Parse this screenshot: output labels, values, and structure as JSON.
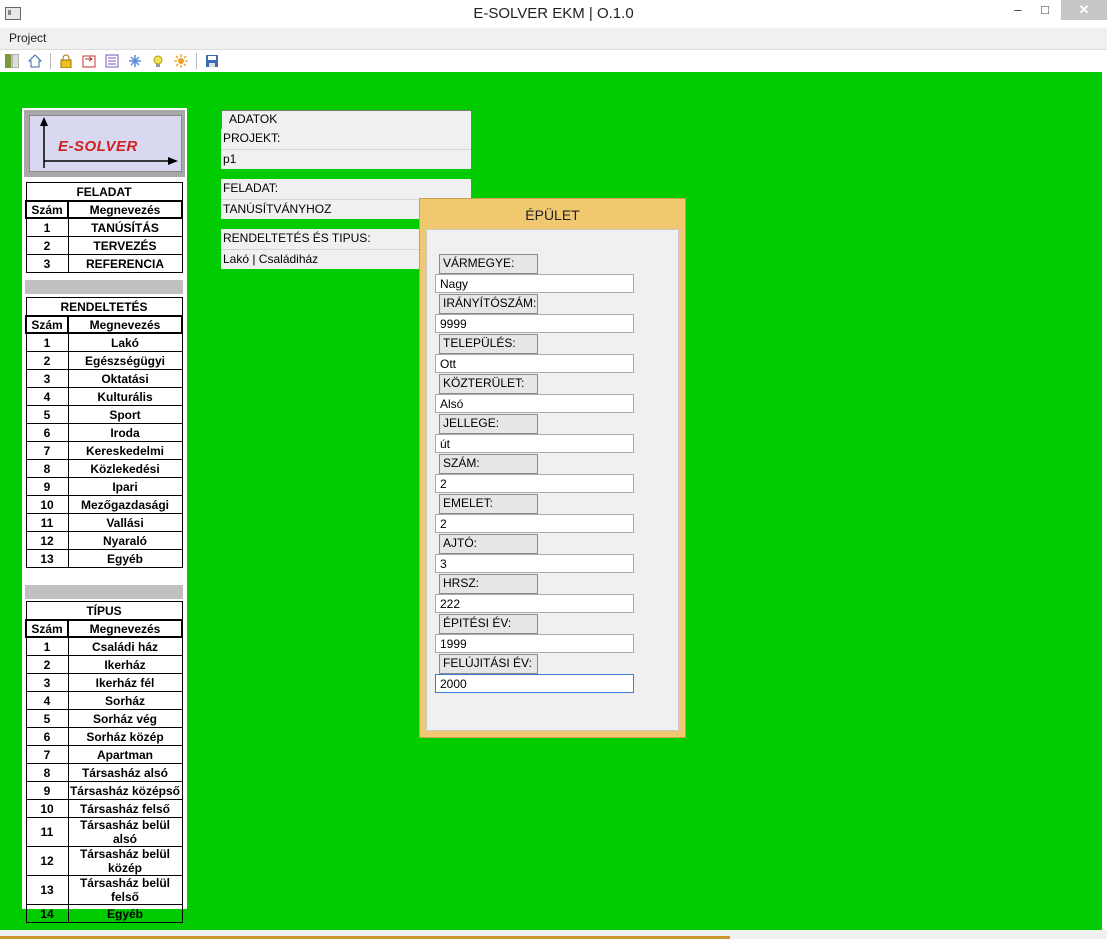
{
  "window": {
    "title": "E-SOLVER EKM | O.1.0",
    "minimize": "–",
    "maximize": "□",
    "close": "✕"
  },
  "menu": {
    "project": "Project"
  },
  "toolbar": {
    "icons": [
      "panel-icon",
      "home-icon",
      "lock-icon",
      "export-icon",
      "list-icon",
      "snowflake-icon",
      "lightbulb-icon",
      "sun-icon",
      "save-icon"
    ]
  },
  "logo": {
    "text": "E-SOLVER"
  },
  "feladat": {
    "title": "FELADAT",
    "col_num": "Szám",
    "col_name": "Megnevezés",
    "rows": [
      {
        "num": "1",
        "name": "TANÚSÍTÁS"
      },
      {
        "num": "2",
        "name": "TERVEZÉS"
      },
      {
        "num": "3",
        "name": "REFERENCIA"
      }
    ]
  },
  "rendeltetes": {
    "title": "RENDELTETÉS",
    "col_num": "Szám",
    "col_name": "Megnevezés",
    "rows": [
      {
        "num": "1",
        "name": "Lakó"
      },
      {
        "num": "2",
        "name": "Egészségügyi"
      },
      {
        "num": "3",
        "name": "Oktatási"
      },
      {
        "num": "4",
        "name": "Kulturális"
      },
      {
        "num": "5",
        "name": "Sport"
      },
      {
        "num": "6",
        "name": "Iroda"
      },
      {
        "num": "7",
        "name": "Kereskedelmi"
      },
      {
        "num": "8",
        "name": "Közlekedési"
      },
      {
        "num": "9",
        "name": "Ipari"
      },
      {
        "num": "10",
        "name": "Mezőgazdasági"
      },
      {
        "num": "11",
        "name": "Vallási"
      },
      {
        "num": "12",
        "name": "Nyaraló"
      },
      {
        "num": "13",
        "name": "Egyéb"
      }
    ]
  },
  "tipus": {
    "title": "TÍPUS",
    "col_num": "Szám",
    "col_name": "Megnevezés",
    "rows": [
      {
        "num": "1",
        "name": "Családi ház"
      },
      {
        "num": "2",
        "name": "Ikerház"
      },
      {
        "num": "3",
        "name": "Ikerház fél"
      },
      {
        "num": "4",
        "name": "Sorház"
      },
      {
        "num": "5",
        "name": "Sorház vég"
      },
      {
        "num": "6",
        "name": "Sorház közép"
      },
      {
        "num": "7",
        "name": "Apartman"
      },
      {
        "num": "8",
        "name": "Társasház alsó"
      },
      {
        "num": "9",
        "name": "Társasház középső"
      },
      {
        "num": "10",
        "name": "Társasház felső"
      },
      {
        "num": "11",
        "name": "Társasház belül alsó"
      },
      {
        "num": "12",
        "name": "Társasház belül közép"
      },
      {
        "num": "13",
        "name": "Társasház belül felső"
      },
      {
        "num": "14",
        "name": "Egyéb"
      }
    ]
  },
  "adatok": {
    "title": "ADATOK",
    "projekt_label": "PROJEKT:",
    "projekt_value": "p1",
    "feladat_label": "FELADAT:",
    "feladat_value": "TANÚSÍTVÁNYHOZ",
    "rendeltetes_label": "RENDELTETÉS ÉS TIPUS:",
    "rendeltetes_value": "Lakó  |  Családiház"
  },
  "epulet": {
    "title": "ÉPÜLET",
    "fields": [
      {
        "label": "VÁRMEGYE:",
        "value": "Nagy"
      },
      {
        "label": "IRÁNYÍTÓSZÁM:",
        "value": "9999"
      },
      {
        "label": "TELEPÜLÉS:",
        "value": "Ott"
      },
      {
        "label": "KÖZTERÜLET:",
        "value": "Alsó"
      },
      {
        "label": "JELLEGE:",
        "value": "út"
      },
      {
        "label": "SZÁM:",
        "value": "2"
      },
      {
        "label": "EMELET:",
        "value": "2"
      },
      {
        "label": "AJTÓ:",
        "value": "3"
      },
      {
        "label": "HRSZ:",
        "value": "222"
      },
      {
        "label": "ÉPITÉSI ÉV:",
        "value": "1999"
      },
      {
        "label": "FELÚJITÁSI ÉV:",
        "value": "2000"
      }
    ]
  },
  "colors": {
    "background": "#00cc00",
    "dialog": "#f0c870",
    "logo_text": "#d02020"
  }
}
